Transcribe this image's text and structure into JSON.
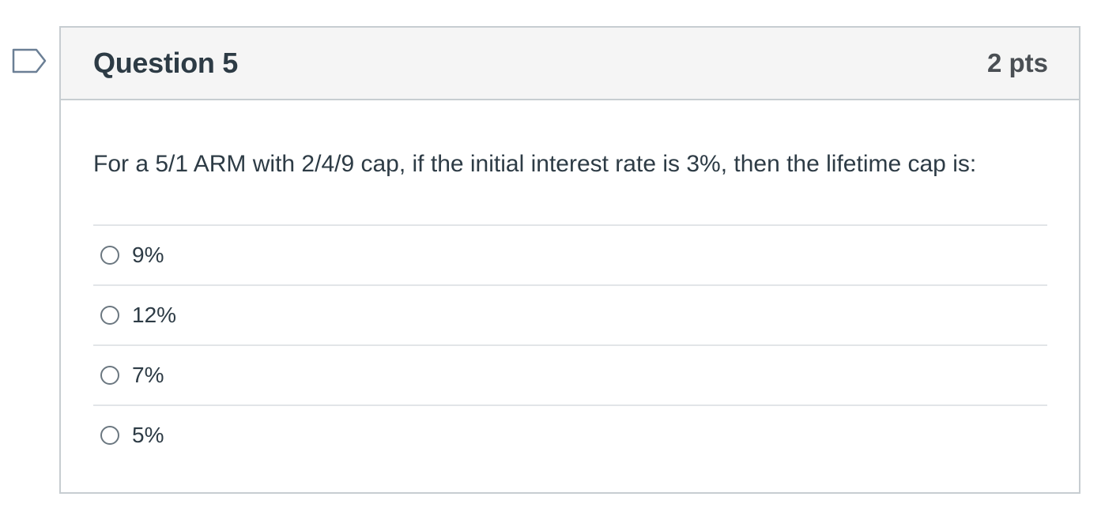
{
  "question": {
    "title": "Question 5",
    "points": "2 pts",
    "text": "For a 5/1 ARM with 2/4/9 cap, if the initial interest rate is 3%, then the lifetime cap is:",
    "answers": [
      {
        "label": "9%"
      },
      {
        "label": "12%"
      },
      {
        "label": "7%"
      },
      {
        "label": "5%"
      }
    ]
  },
  "colors": {
    "header_bg": "#f5f5f5",
    "border": "#c7cdd1",
    "text": "#2d3b45",
    "flag": "#6b7f95"
  },
  "icons": {
    "flag": "flag-question-icon",
    "radio": "radio-button-icon"
  }
}
